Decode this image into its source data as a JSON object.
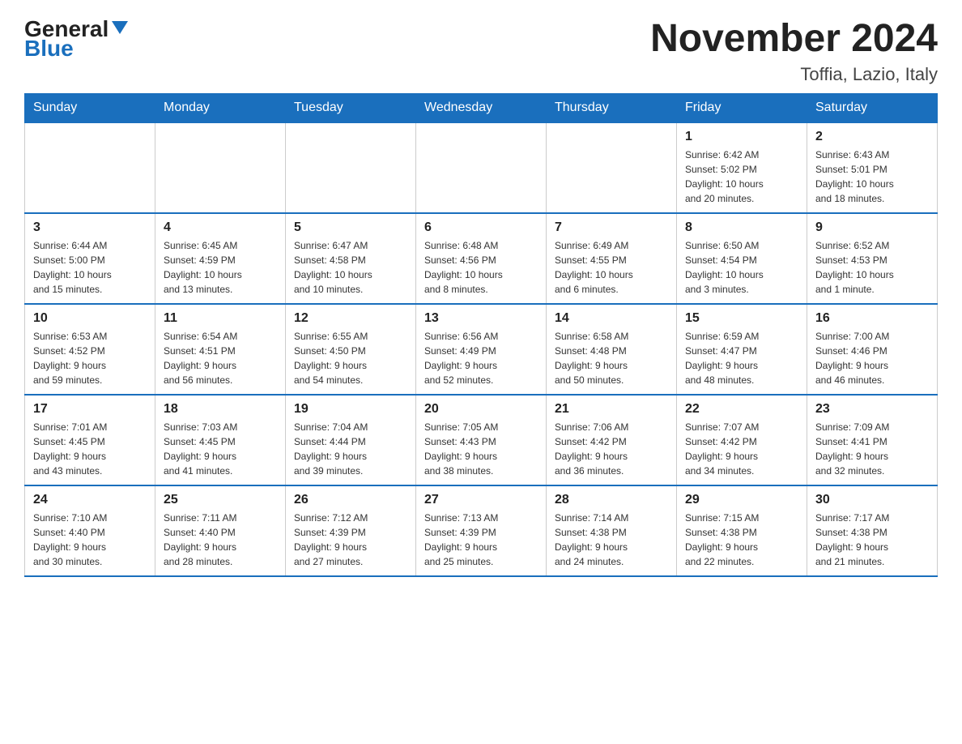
{
  "header": {
    "logo_general": "General",
    "logo_blue": "Blue",
    "title": "November 2024",
    "subtitle": "Toffia, Lazio, Italy"
  },
  "days_of_week": [
    "Sunday",
    "Monday",
    "Tuesday",
    "Wednesday",
    "Thursday",
    "Friday",
    "Saturday"
  ],
  "weeks": [
    [
      {
        "day": "",
        "info": ""
      },
      {
        "day": "",
        "info": ""
      },
      {
        "day": "",
        "info": ""
      },
      {
        "day": "",
        "info": ""
      },
      {
        "day": "",
        "info": ""
      },
      {
        "day": "1",
        "info": "Sunrise: 6:42 AM\nSunset: 5:02 PM\nDaylight: 10 hours\nand 20 minutes."
      },
      {
        "day": "2",
        "info": "Sunrise: 6:43 AM\nSunset: 5:01 PM\nDaylight: 10 hours\nand 18 minutes."
      }
    ],
    [
      {
        "day": "3",
        "info": "Sunrise: 6:44 AM\nSunset: 5:00 PM\nDaylight: 10 hours\nand 15 minutes."
      },
      {
        "day": "4",
        "info": "Sunrise: 6:45 AM\nSunset: 4:59 PM\nDaylight: 10 hours\nand 13 minutes."
      },
      {
        "day": "5",
        "info": "Sunrise: 6:47 AM\nSunset: 4:58 PM\nDaylight: 10 hours\nand 10 minutes."
      },
      {
        "day": "6",
        "info": "Sunrise: 6:48 AM\nSunset: 4:56 PM\nDaylight: 10 hours\nand 8 minutes."
      },
      {
        "day": "7",
        "info": "Sunrise: 6:49 AM\nSunset: 4:55 PM\nDaylight: 10 hours\nand 6 minutes."
      },
      {
        "day": "8",
        "info": "Sunrise: 6:50 AM\nSunset: 4:54 PM\nDaylight: 10 hours\nand 3 minutes."
      },
      {
        "day": "9",
        "info": "Sunrise: 6:52 AM\nSunset: 4:53 PM\nDaylight: 10 hours\nand 1 minute."
      }
    ],
    [
      {
        "day": "10",
        "info": "Sunrise: 6:53 AM\nSunset: 4:52 PM\nDaylight: 9 hours\nand 59 minutes."
      },
      {
        "day": "11",
        "info": "Sunrise: 6:54 AM\nSunset: 4:51 PM\nDaylight: 9 hours\nand 56 minutes."
      },
      {
        "day": "12",
        "info": "Sunrise: 6:55 AM\nSunset: 4:50 PM\nDaylight: 9 hours\nand 54 minutes."
      },
      {
        "day": "13",
        "info": "Sunrise: 6:56 AM\nSunset: 4:49 PM\nDaylight: 9 hours\nand 52 minutes."
      },
      {
        "day": "14",
        "info": "Sunrise: 6:58 AM\nSunset: 4:48 PM\nDaylight: 9 hours\nand 50 minutes."
      },
      {
        "day": "15",
        "info": "Sunrise: 6:59 AM\nSunset: 4:47 PM\nDaylight: 9 hours\nand 48 minutes."
      },
      {
        "day": "16",
        "info": "Sunrise: 7:00 AM\nSunset: 4:46 PM\nDaylight: 9 hours\nand 46 minutes."
      }
    ],
    [
      {
        "day": "17",
        "info": "Sunrise: 7:01 AM\nSunset: 4:45 PM\nDaylight: 9 hours\nand 43 minutes."
      },
      {
        "day": "18",
        "info": "Sunrise: 7:03 AM\nSunset: 4:45 PM\nDaylight: 9 hours\nand 41 minutes."
      },
      {
        "day": "19",
        "info": "Sunrise: 7:04 AM\nSunset: 4:44 PM\nDaylight: 9 hours\nand 39 minutes."
      },
      {
        "day": "20",
        "info": "Sunrise: 7:05 AM\nSunset: 4:43 PM\nDaylight: 9 hours\nand 38 minutes."
      },
      {
        "day": "21",
        "info": "Sunrise: 7:06 AM\nSunset: 4:42 PM\nDaylight: 9 hours\nand 36 minutes."
      },
      {
        "day": "22",
        "info": "Sunrise: 7:07 AM\nSunset: 4:42 PM\nDaylight: 9 hours\nand 34 minutes."
      },
      {
        "day": "23",
        "info": "Sunrise: 7:09 AM\nSunset: 4:41 PM\nDaylight: 9 hours\nand 32 minutes."
      }
    ],
    [
      {
        "day": "24",
        "info": "Sunrise: 7:10 AM\nSunset: 4:40 PM\nDaylight: 9 hours\nand 30 minutes."
      },
      {
        "day": "25",
        "info": "Sunrise: 7:11 AM\nSunset: 4:40 PM\nDaylight: 9 hours\nand 28 minutes."
      },
      {
        "day": "26",
        "info": "Sunrise: 7:12 AM\nSunset: 4:39 PM\nDaylight: 9 hours\nand 27 minutes."
      },
      {
        "day": "27",
        "info": "Sunrise: 7:13 AM\nSunset: 4:39 PM\nDaylight: 9 hours\nand 25 minutes."
      },
      {
        "day": "28",
        "info": "Sunrise: 7:14 AM\nSunset: 4:38 PM\nDaylight: 9 hours\nand 24 minutes."
      },
      {
        "day": "29",
        "info": "Sunrise: 7:15 AM\nSunset: 4:38 PM\nDaylight: 9 hours\nand 22 minutes."
      },
      {
        "day": "30",
        "info": "Sunrise: 7:17 AM\nSunset: 4:38 PM\nDaylight: 9 hours\nand 21 minutes."
      }
    ]
  ]
}
